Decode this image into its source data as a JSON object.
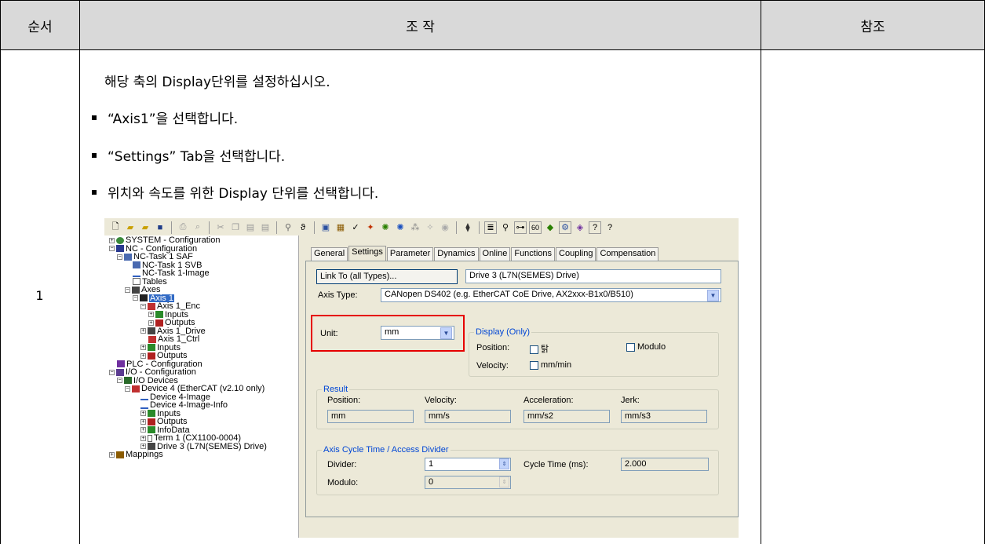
{
  "header": {
    "col1": "순서",
    "col2": "조 작",
    "col3": "참조"
  },
  "step": {
    "number": "1",
    "intro": "해당 축의 Display단위를 설정하십시오.",
    "bullets": [
      "“Axis1”을 선택합니다.",
      "“Settings” Tab을 선택합니다.",
      "위치와 속도를 위한 Display 단위를 선택합니다."
    ]
  },
  "tree": [
    {
      "label": "SYSTEM - Configuration",
      "icon": "system-icon"
    },
    {
      "label": "NC - Configuration",
      "icon": "nc-icon"
    },
    {
      "label": "NC-Task 1 SAF",
      "icon": "task-icon"
    },
    {
      "label": "NC-Task 1 SVB",
      "icon": "task-icon"
    },
    {
      "label": "NC-Task 1-Image",
      "icon": "image-icon"
    },
    {
      "label": "Tables",
      "icon": "table-icon"
    },
    {
      "label": "Axes",
      "icon": "axes-icon"
    },
    {
      "label": "Axis 1",
      "icon": "axis-icon"
    },
    {
      "label": "Axis 1_Enc",
      "icon": "encoder-icon"
    },
    {
      "label": "Inputs",
      "icon": "inputs-icon"
    },
    {
      "label": "Outputs",
      "icon": "outputs-icon"
    },
    {
      "label": "Axis 1_Drive",
      "icon": "drive-icon"
    },
    {
      "label": "Axis 1_Ctrl",
      "icon": "ctrl-icon"
    },
    {
      "label": "Inputs",
      "icon": "inputs-icon"
    },
    {
      "label": "Outputs",
      "icon": "outputs-icon"
    },
    {
      "label": "PLC - Configuration",
      "icon": "plc-icon"
    },
    {
      "label": "I/O - Configuration",
      "icon": "io-icon"
    },
    {
      "label": "I/O Devices",
      "icon": "devices-icon"
    },
    {
      "label": "Device 4 (EtherCAT (v2.10 only)",
      "icon": "ethercat-icon"
    },
    {
      "label": "Device 4-Image",
      "icon": "image-icon"
    },
    {
      "label": "Device 4-Image-Info",
      "icon": "image-icon"
    },
    {
      "label": "Inputs",
      "icon": "inputs-icon"
    },
    {
      "label": "Outputs",
      "icon": "outputs-icon"
    },
    {
      "label": "InfoData",
      "icon": "info-icon"
    },
    {
      "label": "Term 1 (CX1100-0004)",
      "icon": "terminal-icon"
    },
    {
      "label": "Drive 3 (L7N(SEMES) Drive)",
      "icon": "drive-icon"
    },
    {
      "label": "Mappings",
      "icon": "mappings-icon"
    }
  ],
  "tabs": [
    "General",
    "Settings",
    "Parameter",
    "Dynamics",
    "Online",
    "Functions",
    "Coupling",
    "Compensation"
  ],
  "settings": {
    "link_button": "Link To (all Types)...",
    "link_value": "Drive 3 (L7N(SEMES) Drive)",
    "axis_type_label": "Axis Type:",
    "axis_type_value": "CANopen DS402  (e.g. EtherCAT CoE Drive, AX2xxx-B1x0/B510)",
    "unit_label": "Unit:",
    "unit_value": "mm",
    "display_title": "Display (Only)",
    "position_label": "Position:",
    "position_check": "탉",
    "modulo_check": "Modulo",
    "velocity_label": "Velocity:",
    "velocity_check": "mm/min",
    "result_title": "Result",
    "result_position_label": "Position:",
    "result_velocity_label": "Velocity:",
    "result_accel_label": "Acceleration:",
    "result_jerk_label": "Jerk:",
    "result_position": "mm",
    "result_velocity": "mm/s",
    "result_accel": "mm/s2",
    "result_jerk": "mm/s3",
    "cycle_title": "Axis Cycle Time / Access Divider",
    "divider_label": "Divider:",
    "divider_value": "1",
    "cycle_label": "Cycle Time (ms):",
    "cycle_value": "2.000",
    "modulo_label": "Modulo:",
    "modulo_value": "0"
  }
}
